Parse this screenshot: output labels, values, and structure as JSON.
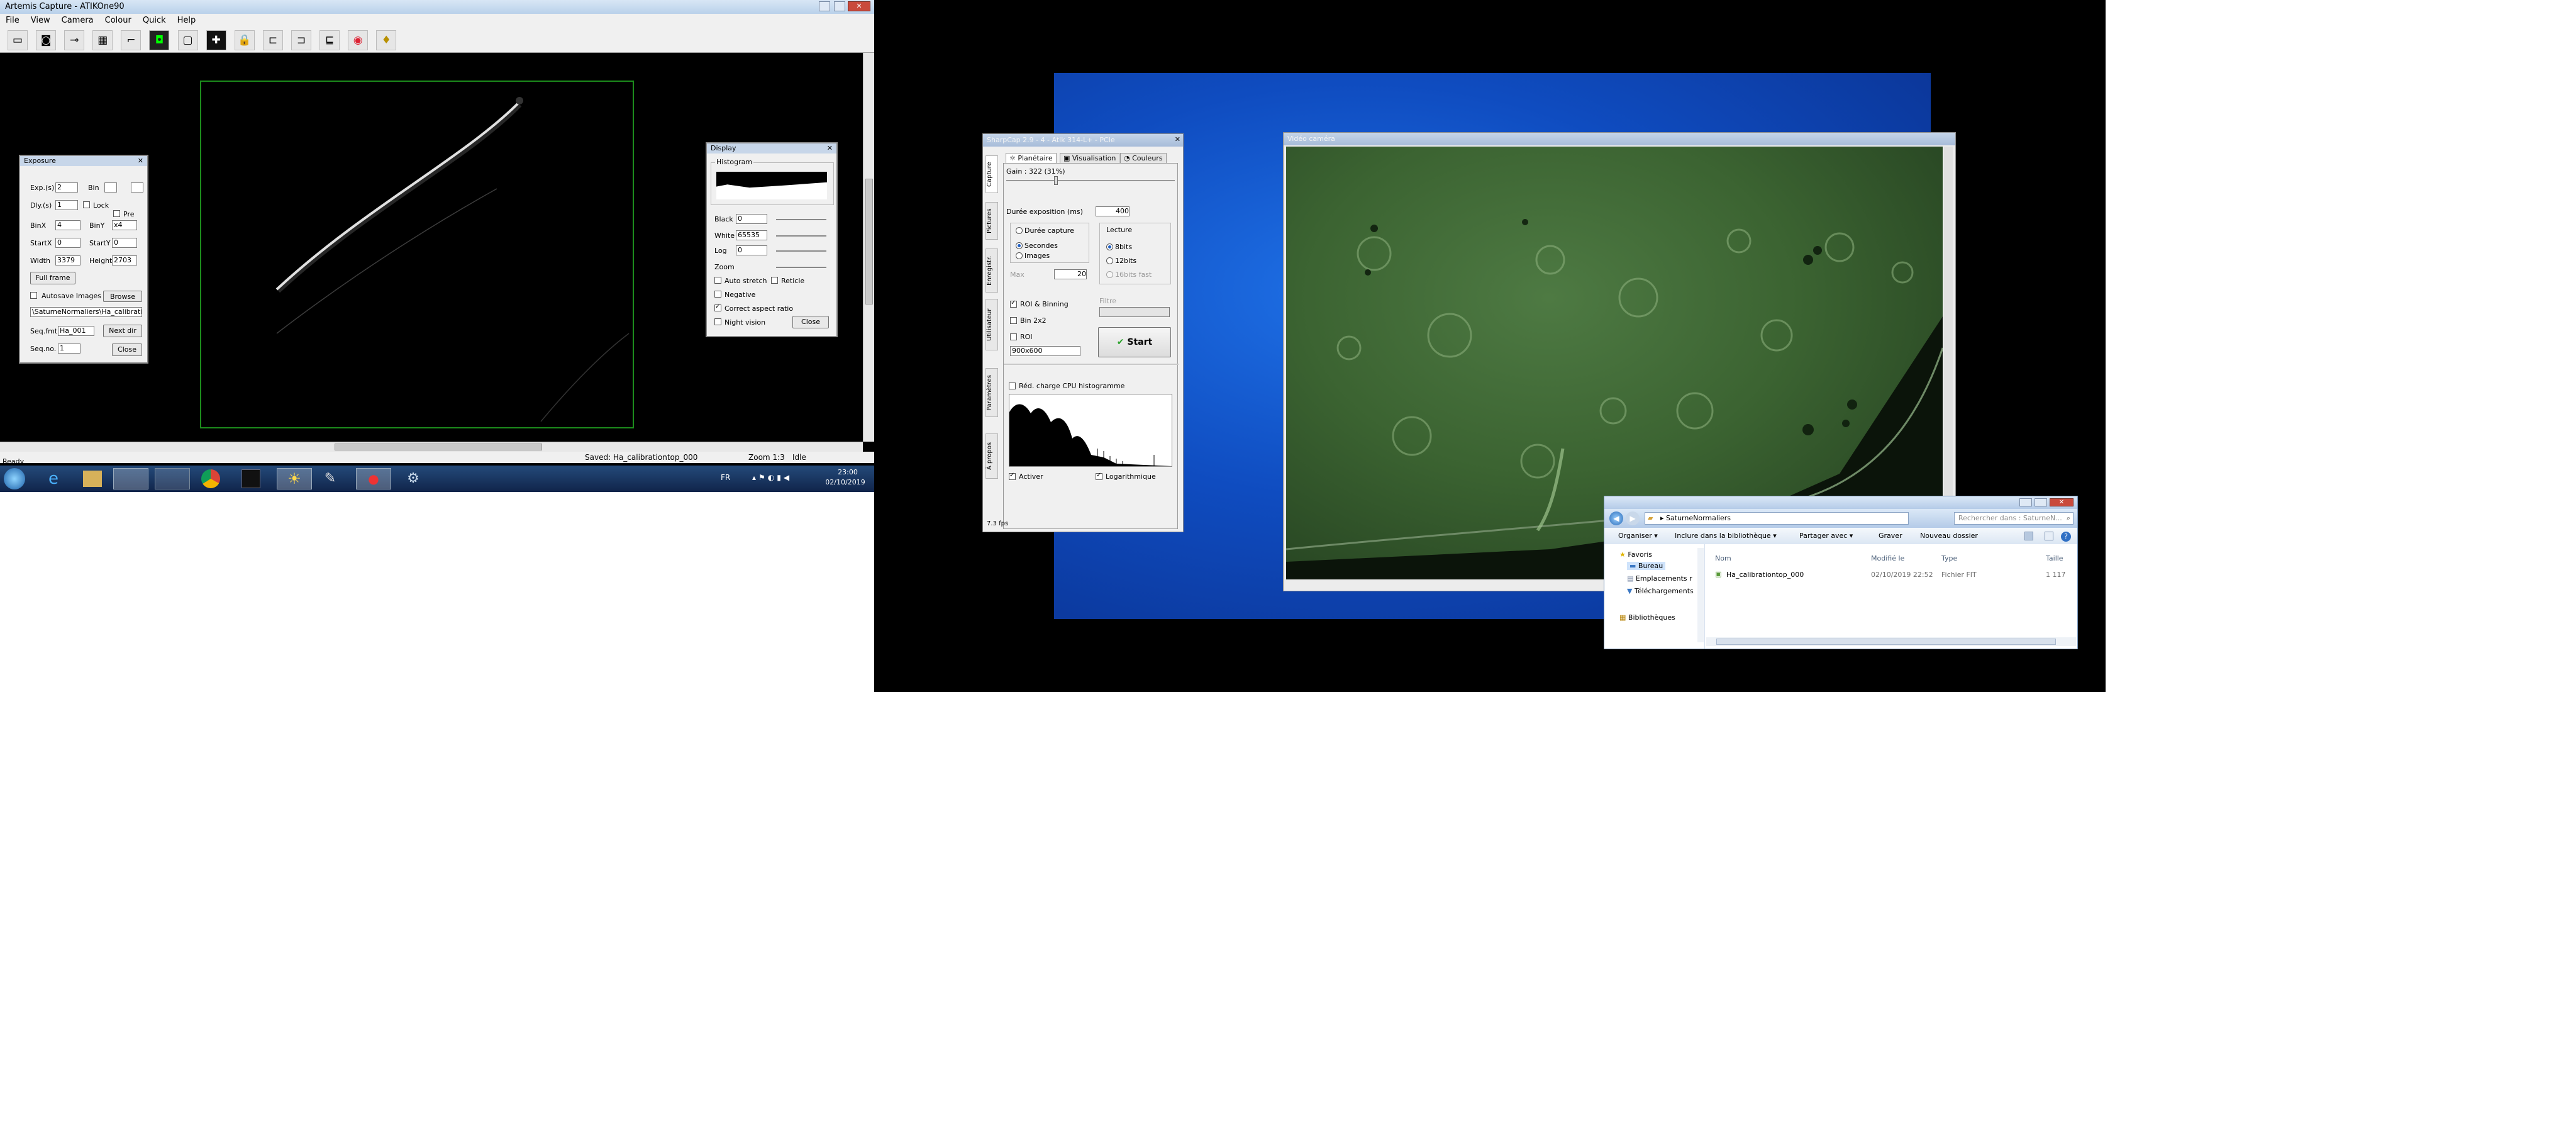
{
  "artemis": {
    "title": "Artemis Capture - ATIKOne90",
    "menu": [
      "File",
      "View",
      "Camera",
      "Colour",
      "Quick",
      "Help"
    ],
    "toolbar_icons": [
      "save-icon",
      "camera-icon",
      "telescope-icon",
      "grid-icon",
      "crosshair-square-icon",
      "target-icon",
      "rectangle-icon",
      "plus-icon",
      "lock-icon",
      "focus-icon",
      "guide-icon",
      "guide2-icon",
      "color-wheel-icon",
      "pin-icon"
    ],
    "exposure_panel": {
      "title": "Exposure",
      "exp_label": "Exp.(s)",
      "exp_value": "2",
      "bin_label": "Bin",
      "dly_label": "Dly.(s)",
      "dly_value": "1",
      "lock_label": "Lock",
      "pre_label": "Pre",
      "binx_label": "BinX",
      "binx_value": "4",
      "biny_label": "BinY",
      "biny_value": "x4",
      "startx_label": "StartX",
      "startx_value": "0",
      "starty_label": "StartY",
      "starty_value": "0",
      "width_label": "Width",
      "width_value": "3379",
      "height_label": "Height",
      "height_value": "2703",
      "fullframe_label": "Full frame",
      "autosave_label": "Autosave Images",
      "browse_label": "Browse",
      "path_value": "\\SaturneNormaliers\\Ha_calibrationtop",
      "seqfmt_label": "Seq.fmt",
      "seqfmt_value": "Ha_001",
      "nextdir_label": "Next dir",
      "seqno_label": "Seq.no.",
      "seqno_value": "1",
      "close_label": "Close"
    },
    "display_panel": {
      "title": "Display",
      "histogram_label": "Histogram",
      "black_label": "Black",
      "black_value": "0",
      "white_label": "White",
      "white_value": "65535",
      "log_label": "Log",
      "log_value": "0",
      "zoom_label": "Zoom",
      "autostretch_label": "Auto stretch",
      "reticle_label": "Reticle",
      "negative_label": "Negative",
      "aspect_label": "Correct aspect ratio",
      "nightvision_label": "Night vision",
      "close_label": "Close"
    },
    "status": {
      "saved": "Saved: Ha_calibrationtop_000",
      "zoom": "Zoom 1:3",
      "state": "Idle",
      "ready": "Ready"
    },
    "taskbar": {
      "lang": "FR",
      "time": "23:00",
      "date": "02/10/2019"
    }
  },
  "sharpcap": {
    "title": "SharpCap 2.9 - 4 - Atik 314-L+ - PCIe",
    "tabs": [
      "Planétaire",
      "Visualisation",
      "Couleurs"
    ],
    "vtabs": [
      "Capture",
      "Pictures",
      "Enregistr.",
      "Utilisateur",
      "Paramètres",
      "À propos"
    ],
    "gain_label": "Gain : 322 (31%)",
    "exposure_label": "Durée exposition (ms)",
    "exposure_value": "400",
    "duration_group": "Durée capture",
    "seconds_label": "Secondes",
    "images_label": "Images",
    "max_label": "Max",
    "max_value": "20",
    "lecture_group": "Lecture",
    "bits8_label": "8bits",
    "bits12_label": "12bits",
    "bits16_label": "16bits fast",
    "roi_binning_label": "ROI & Binning",
    "bin_label": "Bin 2x2",
    "roi_label": "ROI",
    "roi_value": "900x600",
    "filter_label": "Filtre",
    "start_label": "Start",
    "reduce_cpu_label": "Réd. charge CPU histogramme",
    "activate_label": "Activer",
    "log_label": "Logarithmique",
    "fps": "7.3 fps"
  },
  "video_window": {
    "title": "Vidéo caméra"
  },
  "explorer": {
    "breadcrumb": "SaturneNormaliers",
    "search_placeholder": "Rechercher dans : SaturneN...",
    "toolbar": [
      "Organiser",
      "Inclure dans la bibliothèque",
      "Partager avec",
      "Graver",
      "Nouveau dossier"
    ],
    "nav": [
      "Favoris",
      "Bureau",
      "Emplacements r",
      "Téléchargements",
      "Bibliothèques"
    ],
    "columns": [
      "Nom",
      "Modifié le",
      "Type",
      "Taille"
    ],
    "files": [
      {
        "name": "Ha_calibrationtop_000",
        "modified": "02/10/2019 22:52",
        "type": "Fichier FIT",
        "size": "1 117"
      }
    ]
  }
}
